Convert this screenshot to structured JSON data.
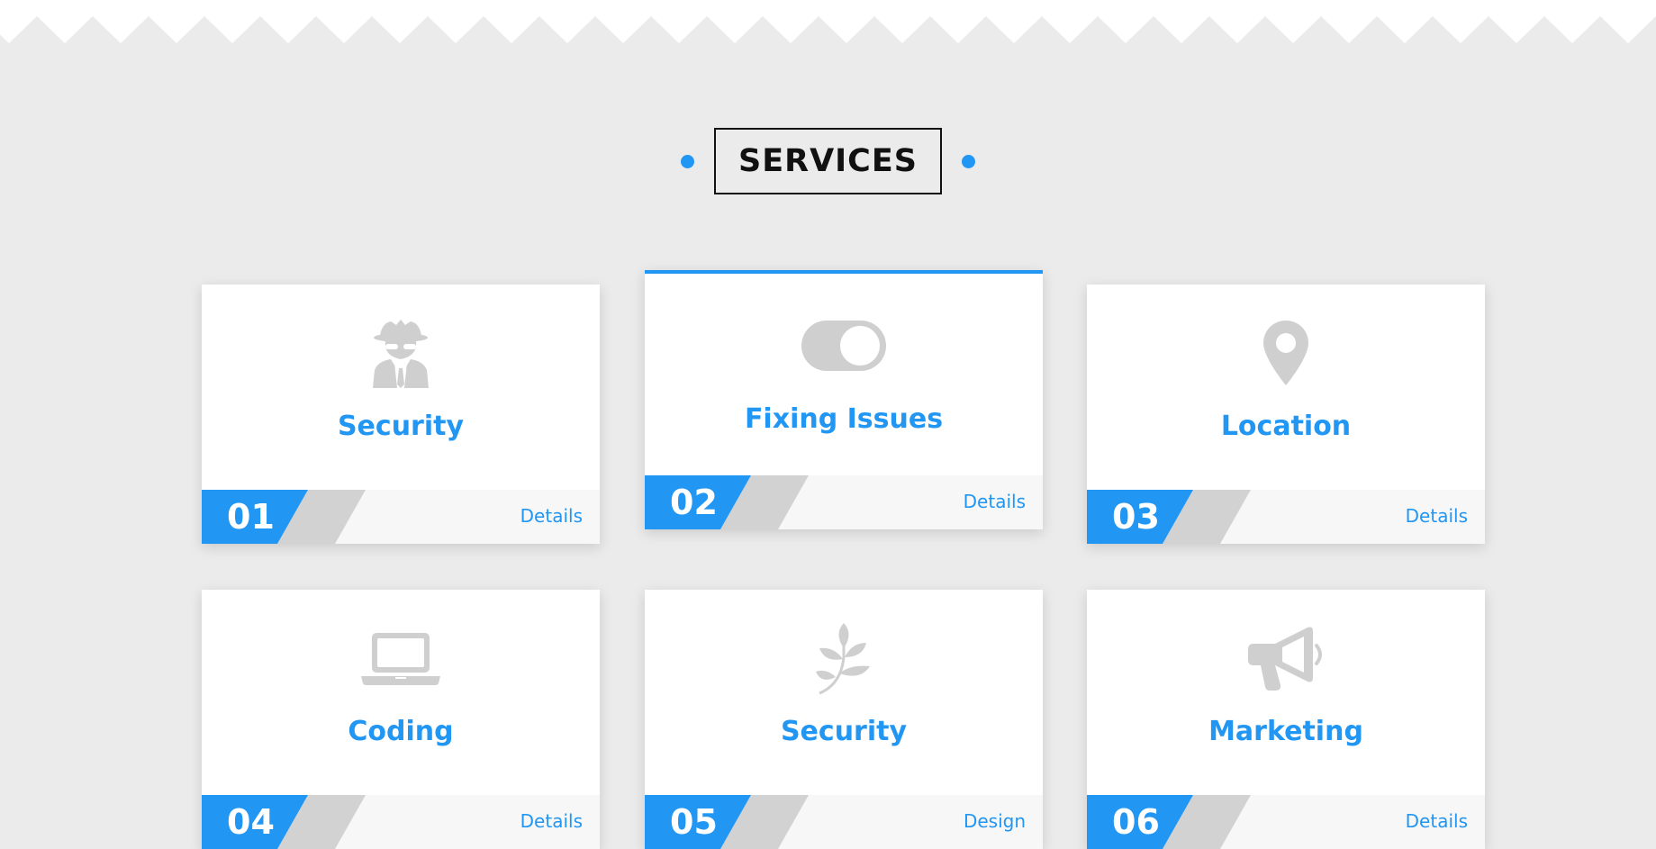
{
  "section": {
    "title": "SERVICES"
  },
  "colors": {
    "accent": "#2196f3",
    "icon": "#cfcfcf",
    "background": "#ebebeb"
  },
  "cards": [
    {
      "number": "01",
      "title": "Security",
      "link": "Details",
      "icon": "spy-icon"
    },
    {
      "number": "02",
      "title": "Fixing Issues",
      "link": "Details",
      "icon": "toggle-icon"
    },
    {
      "number": "03",
      "title": "Location",
      "link": "Details",
      "icon": "location-pin-icon"
    },
    {
      "number": "04",
      "title": "Coding",
      "link": "Details",
      "icon": "laptop-icon"
    },
    {
      "number": "05",
      "title": "Security",
      "link": "Design",
      "icon": "leaf-branch-icon"
    },
    {
      "number": "06",
      "title": "Marketing",
      "link": "Details",
      "icon": "megaphone-icon"
    }
  ]
}
